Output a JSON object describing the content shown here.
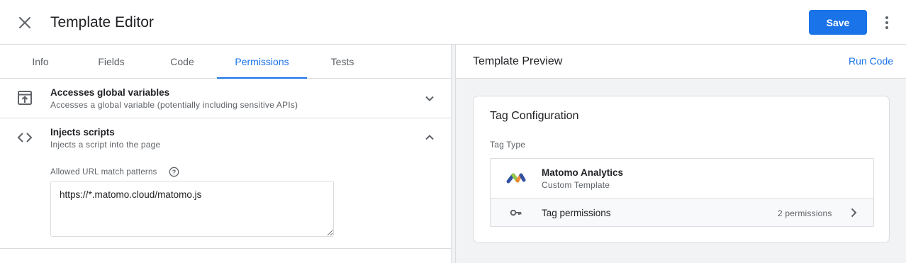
{
  "header": {
    "title": "Template Editor",
    "save_label": "Save",
    "close_icon": "close-icon",
    "more_icon": "more-vert-icon"
  },
  "tabs": [
    {
      "label": "Info",
      "active": false
    },
    {
      "label": "Fields",
      "active": false
    },
    {
      "label": "Code",
      "active": false
    },
    {
      "label": "Permissions",
      "active": true
    },
    {
      "label": "Tests",
      "active": false
    }
  ],
  "permissions": [
    {
      "title": "Accesses global variables",
      "description": "Accesses a global variable (potentially including sensitive APIs)",
      "icon": "open-in-browser-icon",
      "expanded": false
    },
    {
      "title": "Injects scripts",
      "description": "Injects a script into the page",
      "icon": "code-icon",
      "expanded": true,
      "field": {
        "label": "Allowed URL match patterns",
        "value": "https://*.matomo.cloud/matomo.js"
      }
    }
  ],
  "preview": {
    "title": "Template Preview",
    "run_label": "Run Code",
    "card": {
      "title": "Tag Configuration",
      "tag_type_label": "Tag Type",
      "tag_name": "Matomo Analytics",
      "tag_subtitle": "Custom Template",
      "permissions_label": "Tag permissions",
      "permissions_count": "2 permissions"
    }
  },
  "colors": {
    "accent": "#1a73e8",
    "text_primary": "#202124",
    "text_secondary": "#5f6368",
    "border": "#dadce0",
    "panel_bg": "#f1f3f4"
  }
}
